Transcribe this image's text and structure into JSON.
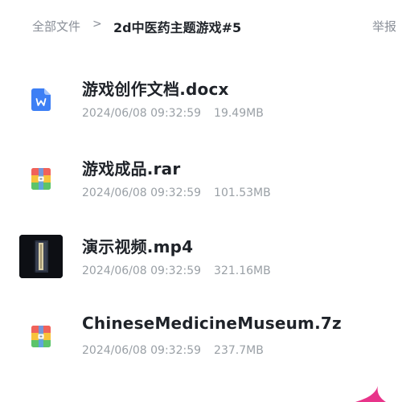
{
  "header": {
    "root_label": "全部文件",
    "separator": ">",
    "current_folder": "2d中医药主题游戏#5",
    "report_label": "举报"
  },
  "files": [
    {
      "name": "游戏创作文档.docx",
      "date": "2024/06/08 09:32:59",
      "size": "19.49MB",
      "icon": "word-doc-icon",
      "icon_color": "#3d7ff5"
    },
    {
      "name": "游戏成品.rar",
      "date": "2024/06/08 09:32:59",
      "size": "101.53MB",
      "icon": "archive-icon"
    },
    {
      "name": "演示视频.mp4",
      "date": "2024/06/08 09:32:59",
      "size": "321.16MB",
      "icon": "video-thumbnail"
    },
    {
      "name": "ChineseMedicineMuseum.7z",
      "date": "2024/06/08 09:32:59",
      "size": "237.7MB",
      "icon": "archive-icon"
    }
  ],
  "colors": {
    "text_primary": "#1f2329",
    "text_secondary": "#9aa0a6",
    "accent_blue": "#3d7ff5",
    "archive_red": "#f0625a",
    "archive_yellow": "#f7c33b",
    "archive_green": "#5cc46a",
    "archive_blue": "#5fa0f0"
  }
}
